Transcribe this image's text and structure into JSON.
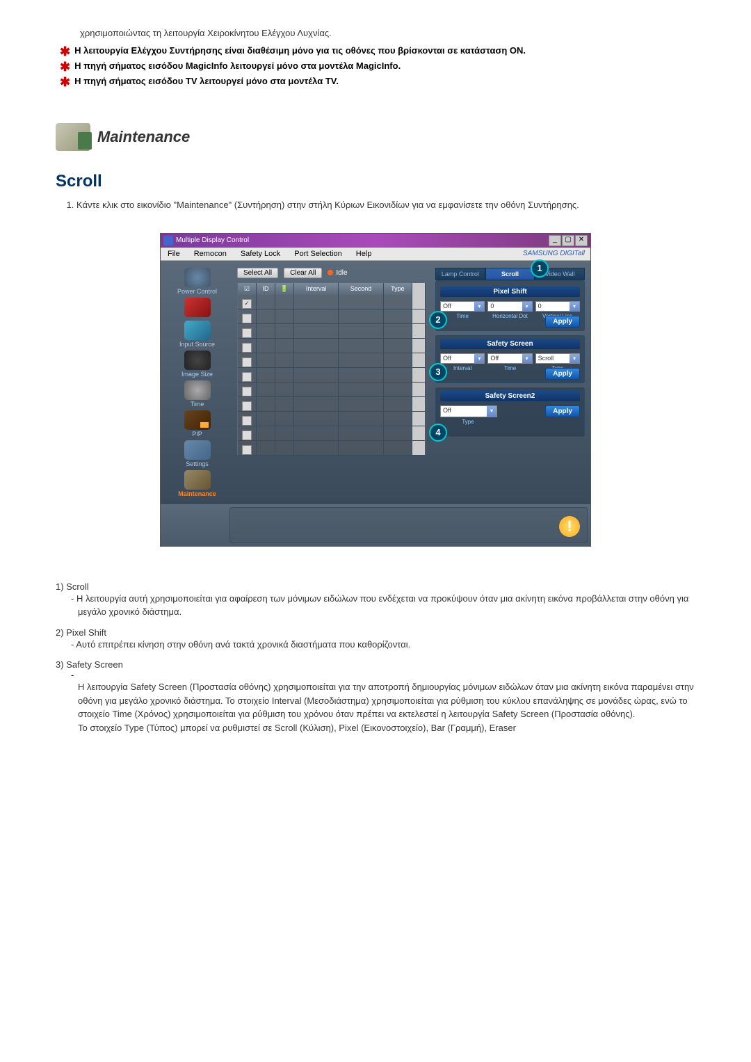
{
  "intro": "χρησιμοποιώντας τη λειτουργία Χειροκίνητου Ελέγχου Λυχνίας.",
  "bullets": [
    "Η λειτουργία Ελέγχου Συντήρησης είναι διαθέσιμη μόνο για τις οθόνες που βρίσκονται σε κατάσταση ON.",
    "Η πηγή σήματος εισόδου MagicInfo λειτουργεί μόνο στα μοντέλα MagicInfo.",
    "Η πηγή σήματος εισόδου TV λειτουργεί μόνο στα μοντέλα TV."
  ],
  "section_title": "Maintenance",
  "scroll_title": "Scroll",
  "scroll_step1": "Κάντε κλικ στο εικονίδιο \"Maintenance\" (Συντήρηση) στην στήλη Κύριων Εικονιδίων για να εμφανίσετε την οθόνη Συντήρησης.",
  "app": {
    "title": "Multiple Display Control",
    "menu": [
      "File",
      "Remocon",
      "Safety Lock",
      "Port Selection",
      "Help"
    ],
    "brand": "SAMSUNG DIGITall",
    "select_all": "Select All",
    "clear_all": "Clear All",
    "idle": "Idle",
    "columns": {
      "id": "ID",
      "interval": "Interval",
      "second": "Second",
      "type": "Type"
    },
    "sidebar": [
      "Power Control",
      " ",
      "Input Source",
      "Image Size",
      "Time",
      "PIP",
      "Settings",
      "Maintenance"
    ],
    "tabs": [
      "Lamp Control",
      "Scroll",
      "Video Wall"
    ],
    "pixel_shift": {
      "title": "Pixel Shift",
      "off": "Off",
      "zero": "0",
      "labels": [
        "Time",
        "Horizontal Dot",
        "Vertical Line"
      ],
      "apply": "Apply"
    },
    "safety_screen": {
      "title": "Safety Screen",
      "off": "Off",
      "scroll": "Scroll",
      "labels": [
        "Interval",
        "Time",
        "Type"
      ],
      "apply": "Apply"
    },
    "safety_screen2": {
      "title": "Safety Screen2",
      "off": "Off",
      "type_label": "Type",
      "apply": "Apply"
    }
  },
  "desc": {
    "d1_title": "1)  Scroll",
    "d1_body": "- Η λειτουργία αυτή χρησιμοποιείται για αφαίρεση των μόνιμων ειδώλων που ενδέχεται να προκύψουν όταν μια ακίνητη εικόνα προβάλλεται στην οθόνη για μεγάλο χρονικό διάστημα.",
    "d2_title": "2)  Pixel Shift",
    "d2_body": "- Αυτό επιτρέπει κίνηση στην οθόνη ανά τακτά χρονικά διαστήματα που καθορίζονται.",
    "d3_title": "3)  Safety Screen",
    "d3_body1": "Η λειτουργία Safety Screen (Προστασία οθόνης) χρησιμοποιείται για την αποτροπή δημιουργίας μόνιμων ειδώλων όταν μια ακίνητη εικόνα παραμένει στην οθόνη για μεγάλο χρονικό διάστημα.  Το στοιχείο Interval (Μεσοδιάστημα) χρησιμοποιείται για ρύθμιση του κύκλου επανάληψης σε μονάδες ώρας, ενώ το στοιχείο Time (Χρόνος) χρησιμοποιείται για ρύθμιση του χρόνου όταν πρέπει να εκτελεστεί η λειτουργία Safety Screen (Προστασία οθόνης).",
    "d3_body2": "Το στοιχείο Type (Τύπος) μπορεί να ρυθμιστεί σε Scroll (Κύλιση), Pixel (Εικονοστοιχείο), Bar (Γραμμή), Eraser"
  }
}
